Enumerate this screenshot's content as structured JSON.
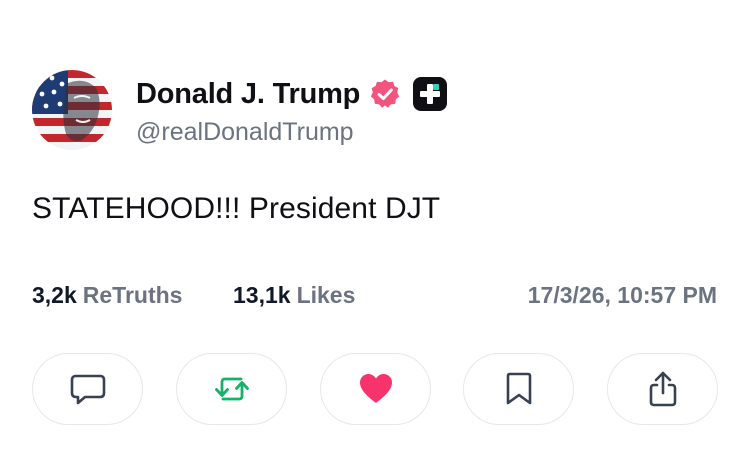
{
  "post": {
    "author": {
      "display_name": "Donald J. Trump",
      "handle": "@realDonaldTrump",
      "verified_icon": "verified-badge-icon",
      "plus_icon": "truth-plus-icon"
    },
    "text": "STATEHOOD!!! President DJT",
    "stats": {
      "retruths_count": "3,2k",
      "retruths_label": "ReTruths",
      "likes_count": "13,1k",
      "likes_label": "Likes",
      "timestamp": "17/3/26, 10:57 PM"
    },
    "actions": [
      {
        "name": "reply",
        "icon": "chat-bubble-icon"
      },
      {
        "name": "retruth",
        "icon": "repost-icon"
      },
      {
        "name": "like",
        "icon": "heart-icon"
      },
      {
        "name": "bookmark",
        "icon": "bookmark-icon"
      },
      {
        "name": "share",
        "icon": "share-icon"
      }
    ]
  },
  "colors": {
    "verified_pink": "#f2547d",
    "retruth_green": "#17b26a",
    "like_pink": "#f6336b",
    "muted_text": "#6b7280",
    "button_border": "#e6e7eb"
  }
}
